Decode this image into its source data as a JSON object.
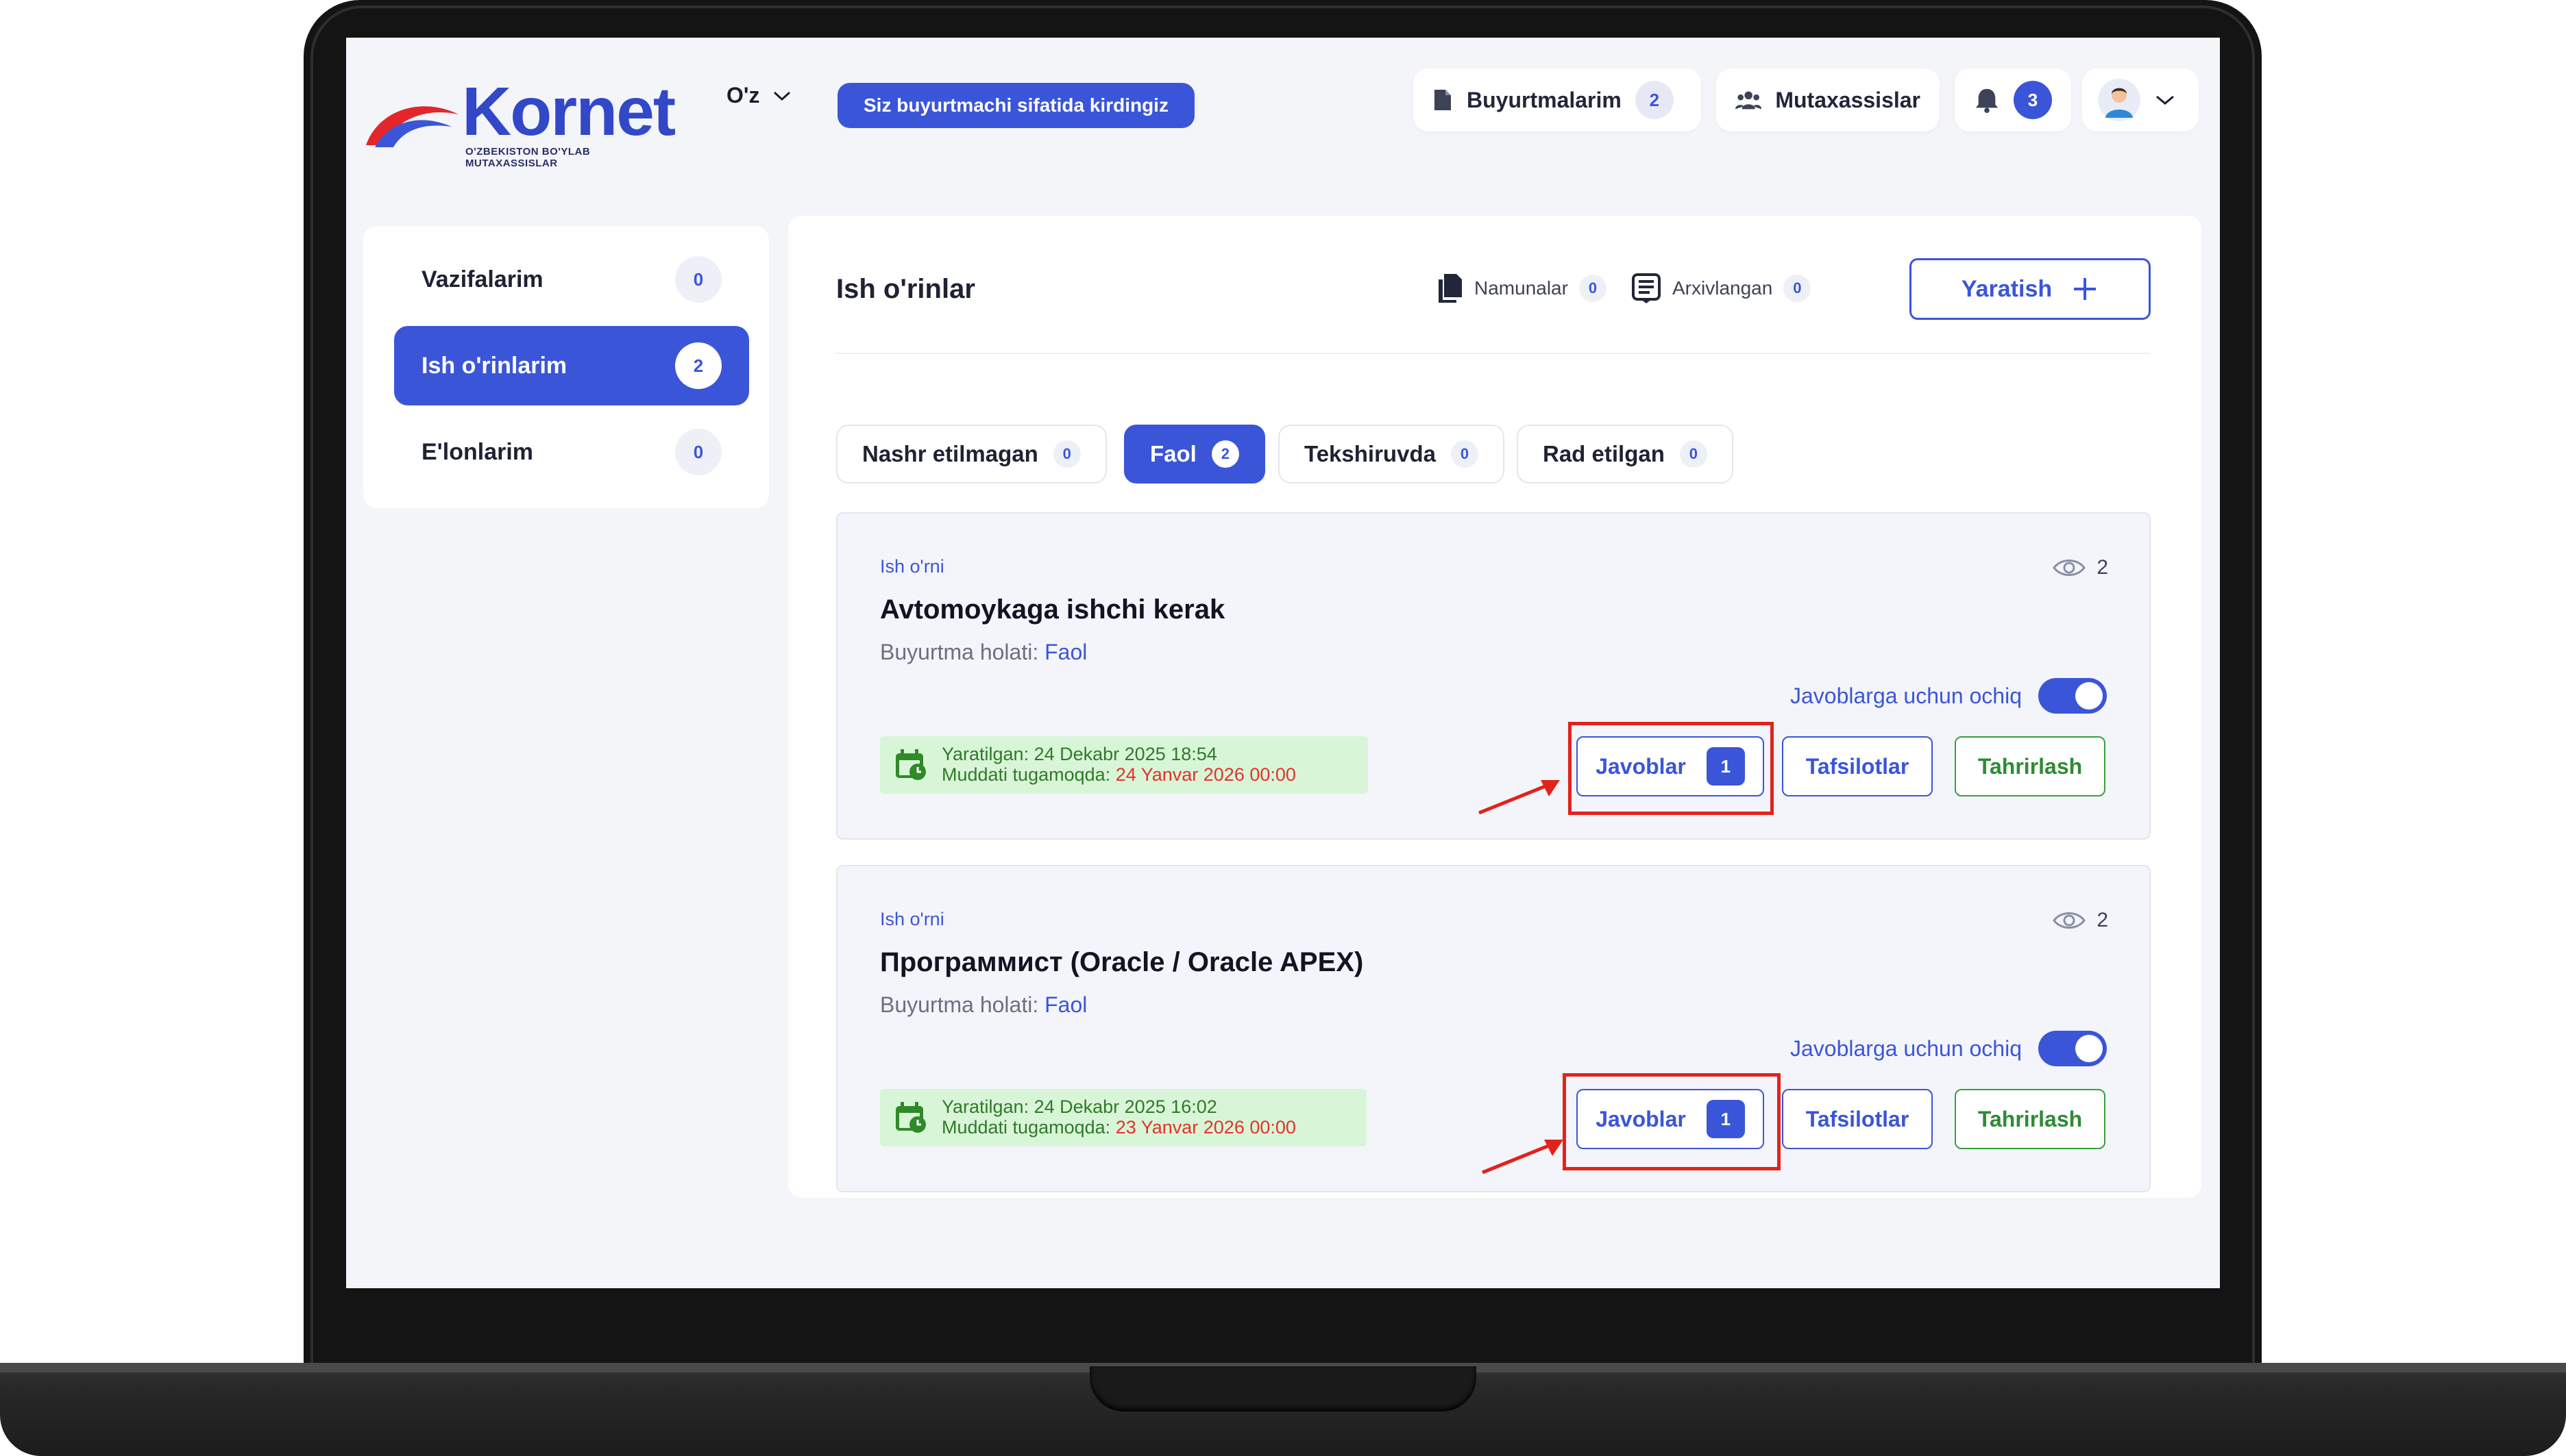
{
  "header": {
    "logo_text": "Kornet",
    "logo_subtitle": "O'ZBEKISTON BO'YLAB MUTAXASSISLAR",
    "language": "O'z",
    "role_notice": "Siz buyurtmachi sifatida kirdingiz",
    "orders": {
      "label": "Buyurtmalarim",
      "count": "2"
    },
    "experts": {
      "label": "Mutaxassislar"
    },
    "notifications": {
      "count": "3"
    }
  },
  "sidebar": {
    "items": [
      {
        "label": "Vazifalarim",
        "count": "0",
        "active": false
      },
      {
        "label": "Ish o'rinlarim",
        "count": "2",
        "active": true
      },
      {
        "label": "E'lonlarim",
        "count": "0",
        "active": false
      }
    ]
  },
  "main": {
    "title": "Ish o'rinlar",
    "templates": {
      "label": "Namunalar",
      "count": "0"
    },
    "archived": {
      "label": "Arxivlangan",
      "count": "0"
    },
    "create_label": "Yaratish",
    "tabs": [
      {
        "label": "Nashr etilmagan",
        "count": "0",
        "active": false
      },
      {
        "label": "Faol",
        "count": "2",
        "active": true
      },
      {
        "label": "Tekshiruvda",
        "count": "0",
        "active": false
      },
      {
        "label": "Rad etilgan",
        "count": "0",
        "active": false
      }
    ],
    "cards": [
      {
        "type": "Ish o'rni",
        "views": "2",
        "title": "Avtomoykaga ishchi kerak",
        "status_label": "Buyurtma holati:",
        "status_value": "Faol",
        "toggle_label": "Javoblarga uchun ochiq",
        "toggle_on": true,
        "created_label": "Yaratilgan:",
        "created_value": "24 Dekabr 2025 18:54",
        "deadline_label": "Muddati tugamoqda:",
        "deadline_value": "24 Yanvar 2026 00:00",
        "responses_label": "Javoblar",
        "responses_count": "1",
        "details_label": "Tafsilotlar",
        "edit_label": "Tahrirlash"
      },
      {
        "type": "Ish o'rni",
        "views": "2",
        "title": "Программист (Oracle / Oracle APEX)",
        "status_label": "Buyurtma holati:",
        "status_value": "Faol",
        "toggle_label": "Javoblarga uchun ochiq",
        "toggle_on": true,
        "created_label": "Yaratilgan:",
        "created_value": "24 Dekabr 2025 16:02",
        "deadline_label": "Muddati tugamoqda:",
        "deadline_value": "23 Yanvar 2026 00:00",
        "responses_label": "Javoblar",
        "responses_count": "1",
        "details_label": "Tafsilotlar",
        "edit_label": "Tahrirlash"
      }
    ]
  },
  "colors": {
    "accent": "#3b55d9",
    "success": "#33a23a",
    "danger": "#e0342b",
    "highlight": "#e3221c"
  }
}
